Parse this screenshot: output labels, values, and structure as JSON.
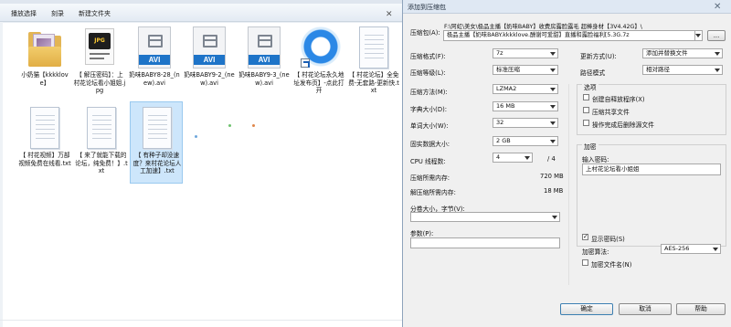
{
  "explorer": {
    "toolbar": {
      "items": [
        "播放选择",
        "刻录",
        "新建文件夹"
      ]
    },
    "files": [
      {
        "name": "小奶猫【kkkklove】",
        "type": "folder"
      },
      {
        "name": "【 解压密码】：上村花论坛看小姐姐.jpg",
        "type": "jpg"
      },
      {
        "name": "奶味BABY8-28_(new).avi",
        "type": "avi",
        "badge": "AVI"
      },
      {
        "name": "奶味BABY9-2_(new).avi",
        "type": "avi",
        "badge": "AVI"
      },
      {
        "name": "奶味BABY9-3_(new).avi",
        "type": "avi",
        "badge": "AVI"
      },
      {
        "name": "【 村花论坛永久地址发布页】-点此打开",
        "type": "url"
      },
      {
        "name": "【 村花论坛】全免费-无套路-更新快.txt",
        "type": "txt"
      },
      {
        "name": "【 村花视频】万部视频免费在线看.txt",
        "type": "txt"
      },
      {
        "name": "【 来了就能下载的论坛，纯免费！】.txt",
        "type": "txt"
      },
      {
        "name": "【 有种子却没速度？来村花论坛人工加速】.txt",
        "type": "txt",
        "selected": true
      }
    ]
  },
  "dialog": {
    "title": "添加到压缩包",
    "close_icon": "close-icon",
    "archive": {
      "label": "压缩包(A):",
      "path_line1": "F:\\阿虹\\美女\\极品主播【奶味BABY】收费房露脸露毛 超棒身材【3V4.42G】\\",
      "path_line2": "极品主播【奶味BABY.kkkklove.酬谢可爱甜】直播和露脸福利[5.3G.7z",
      "browse_label": "..."
    },
    "format": {
      "label": "压缩格式(F):",
      "value": "7z"
    },
    "level": {
      "label": "压缩等级(L):",
      "value": "标准压缩"
    },
    "method": {
      "label": "压缩方法(M):",
      "value": "LZMA2"
    },
    "dict": {
      "label": "字典大小(D):",
      "value": "16 MB"
    },
    "word": {
      "label": "单词大小(W):",
      "value": "32"
    },
    "solid": {
      "label": "固实数据大小:",
      "value": "2 GB"
    },
    "cpu": {
      "label": "CPU 线程数:",
      "value": "4",
      "total": "/ 4"
    },
    "mem_compress": {
      "label": "压缩所需内存:",
      "value": "720 MB"
    },
    "mem_decompress": {
      "label": "解压缩所需内存:",
      "value": "18 MB"
    },
    "split": {
      "label": "分卷大小，字节(V):",
      "value": ""
    },
    "params": {
      "label": "参数(P):",
      "value": ""
    },
    "update_mode": {
      "label": "更新方式(U):",
      "value": "添加并替换文件"
    },
    "path_mode": {
      "label": "路径模式",
      "value": "相对路径"
    },
    "options": {
      "title": "选项",
      "items": [
        {
          "label": "创建自释放程序(X)",
          "checked": false
        },
        {
          "label": "压缩共享文件",
          "checked": false
        },
        {
          "label": "操作完成后删除源文件",
          "checked": false
        }
      ]
    },
    "encryption": {
      "title": "加密",
      "password_label": "输入密码:",
      "password_value": "上村花论坛看小姐姐",
      "show_password_label": "显示密码(S)",
      "show_password_checked": true,
      "method_label": "加密算法:",
      "method_value": "AES-256",
      "encrypt_names_label": "加密文件名(N)",
      "encrypt_names_checked": false
    },
    "buttons": {
      "ok": "确定",
      "cancel": "取消",
      "help": "帮助"
    }
  }
}
